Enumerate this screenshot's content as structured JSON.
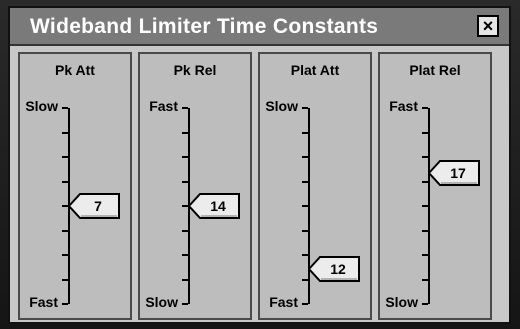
{
  "window": {
    "title": "Wideband Limiter Time Constants",
    "close_label": "×"
  },
  "sliders": [
    {
      "title": "Pk Att",
      "top_label": "Slow",
      "bottom_label": "Fast",
      "value": "7",
      "level": 0.5
    },
    {
      "title": "Pk Rel",
      "top_label": "Fast",
      "bottom_label": "Slow",
      "value": "14",
      "level": 0.5
    },
    {
      "title": "Plat Att",
      "top_label": "Slow",
      "bottom_label": "Fast",
      "value": "12",
      "level": 0.18
    },
    {
      "title": "Plat Rel",
      "top_label": "Fast",
      "bottom_label": "Slow",
      "value": "17",
      "level": 0.67
    }
  ]
}
